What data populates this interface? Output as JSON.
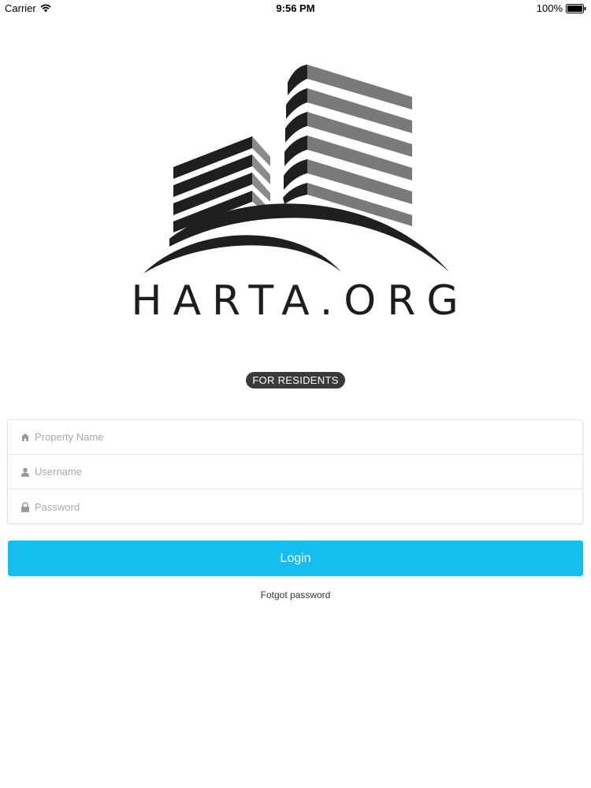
{
  "status_bar": {
    "carrier": "Carrier",
    "time": "9:56 PM",
    "battery": "100%"
  },
  "logo": {
    "text": "HARTA.ORG"
  },
  "badge": {
    "label": "FOR RESIDENTS"
  },
  "form": {
    "fields": [
      {
        "icon": "house-icon",
        "placeholder": "Property Name",
        "value": ""
      },
      {
        "icon": "user-icon",
        "placeholder": "Username",
        "value": ""
      },
      {
        "icon": "lock-icon",
        "placeholder": "Password",
        "value": ""
      }
    ]
  },
  "login_button": {
    "label": "Login",
    "color": "#14bff0"
  },
  "forgot_link": {
    "label": "Fotgot password"
  }
}
